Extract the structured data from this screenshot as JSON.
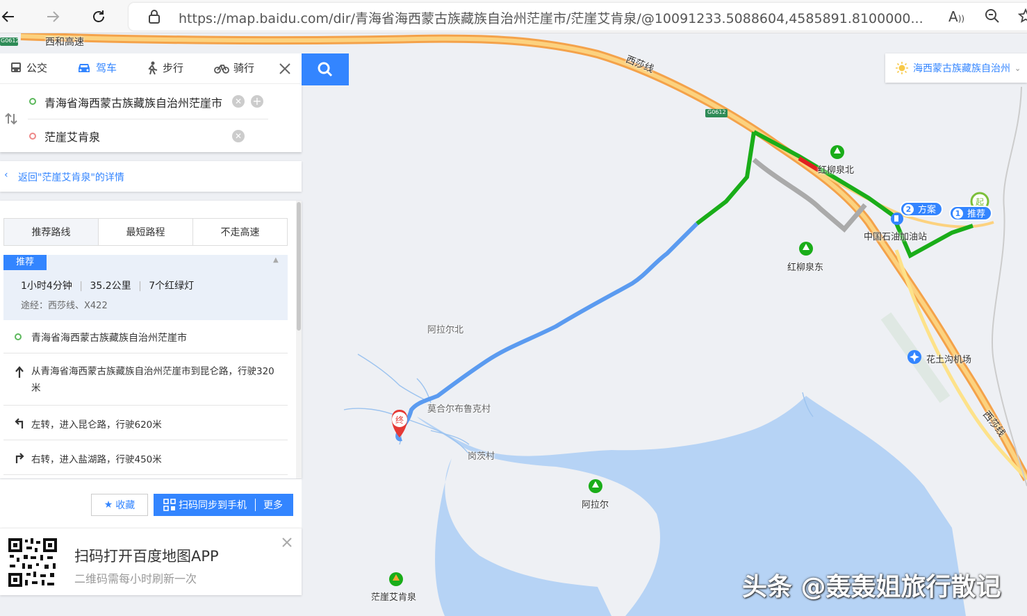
{
  "browser": {
    "url": "https://map.baidu.com/dir/青海省海西蒙古族藏族自治州茫崖市/茫崖艾肯泉/@10091233.5088604,4585891.8100000..."
  },
  "modes": [
    {
      "label": "公交",
      "icon": "bus-icon"
    },
    {
      "label": "驾车",
      "icon": "car-icon"
    },
    {
      "label": "步行",
      "icon": "walk-icon"
    },
    {
      "label": "骑行",
      "icon": "bike-icon"
    }
  ],
  "route": {
    "origin": "青海省海西蒙古族藏族自治州茫崖市",
    "destination": "茫崖艾肯泉"
  },
  "back_link": "返回\"茫崖艾肯泉\"的详情",
  "tabs": [
    "推荐路线",
    "最短路程",
    "不走高速"
  ],
  "plan": {
    "tag": "推荐",
    "duration": "1小时4分钟",
    "distance": "35.2公里",
    "lights": "7个红绿灯",
    "via": "途经：西莎线、X422"
  },
  "steps": [
    {
      "text": "青海省海西蒙古族藏族自治州茫崖市",
      "icon": "start-dot-icon"
    },
    {
      "text": "从青海省海西蒙古族藏族自治州茫崖市到昆仑路，行驶320米",
      "icon": "straight-arrow-icon"
    },
    {
      "text": "左转，进入昆仑路，行驶620米",
      "icon": "turn-left-icon"
    },
    {
      "text": "右转，进入盐湖路，行驶450米",
      "icon": "turn-right-icon"
    }
  ],
  "actions": {
    "save": "收藏",
    "sync": "扫码同步到手机",
    "more": "更多"
  },
  "qr": {
    "title": "扫码打开百度地图APP",
    "subtitle": "二维码需每小时刷新一次"
  },
  "city": "海西蒙古族藏族自治州",
  "map_labels": {
    "highway_top": "西和高速",
    "g0612_a": "G0612",
    "g0612_b": "G0612",
    "xisha_1": "西莎线",
    "xisha_2": "西莎线",
    "hongliu_north": "红柳泉北",
    "hongliu_east": "红柳泉东",
    "gas_station": "中国石油加油站",
    "alaerbei": "阿拉尔北",
    "mohe": "莫合尔布鲁克村",
    "gangci": "岗茨村",
    "alaer": "阿拉尔",
    "aikenquan": "茫崖艾肯泉",
    "airport": "花土沟机场",
    "end_marker": "终",
    "start_marker": "起"
  },
  "badges": [
    {
      "n": "1",
      "label": "推荐"
    },
    {
      "n": "2",
      "label": "方案"
    }
  ],
  "watermark": "头条 @轰轰姐旅行散记",
  "colors": {
    "accent": "#3385ff",
    "route_green": "#1aad19",
    "route_blue": "#5b9bf0",
    "water": "#b6d3f5",
    "highway": "#f9b55f"
  }
}
